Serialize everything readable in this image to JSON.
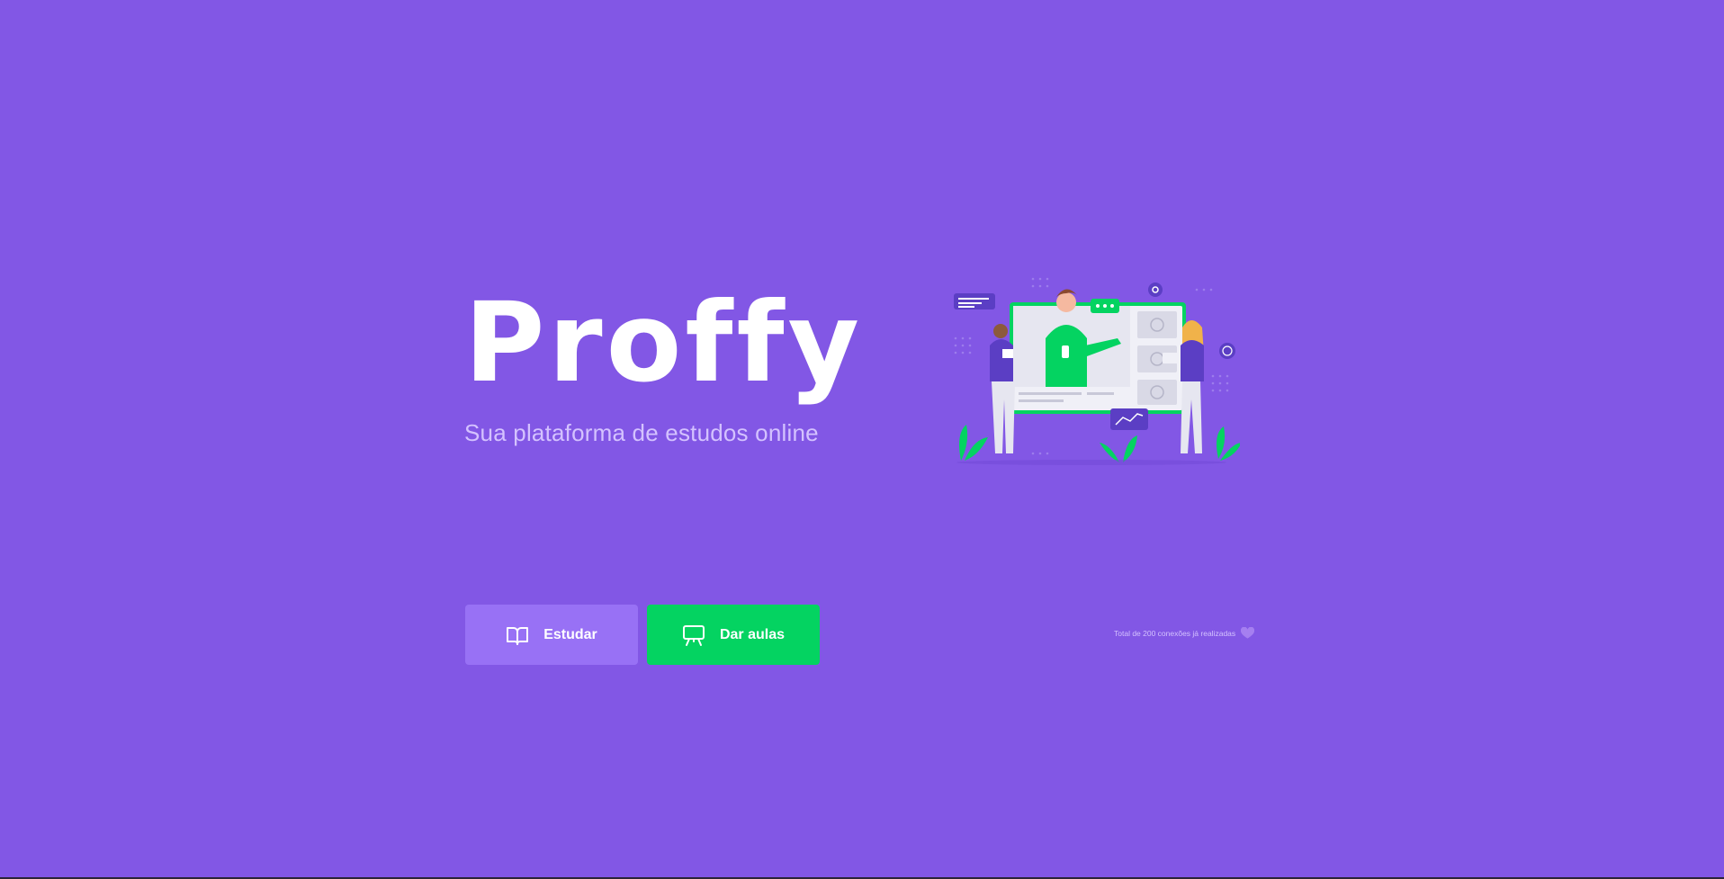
{
  "brand": {
    "logo_text": "Proffy",
    "tagline": "Sua plataforma de estudos online"
  },
  "hero": {
    "illustration": "online-teaching-illustration"
  },
  "actions": {
    "study_label": "Estudar",
    "study_icon": "book-open-icon",
    "give_classes_label": "Dar aulas",
    "give_classes_icon": "presentation-board-icon"
  },
  "footer": {
    "total_connections_text": "Total de 200 conexões já realizadas",
    "heart_icon": "purple-heart-icon"
  },
  "colors": {
    "background": "#8257e5",
    "study_button": "#9871f5",
    "give_button": "#04d361",
    "tagline": "#d4c2ff"
  }
}
